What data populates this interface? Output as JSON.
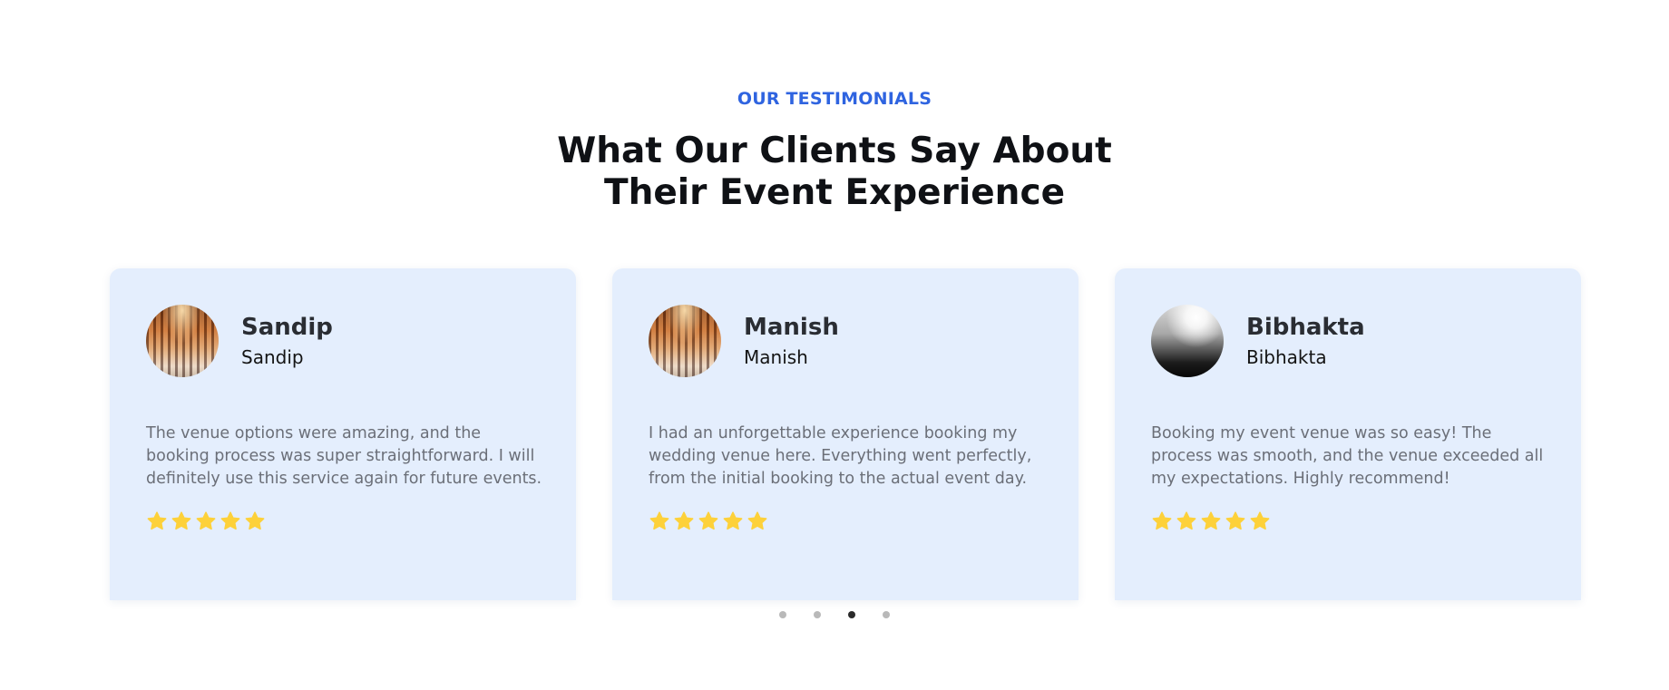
{
  "section": {
    "eyebrow": "OUR TESTIMONIALS",
    "heading": "What Our Clients Say About Their Event Experience"
  },
  "testimonials": [
    {
      "name": "Sandip",
      "role": "Sandip",
      "avatar_icon": "cathedral-arches-photo",
      "quote": "The venue options were amazing, and the booking process was super straightforward. I will definitely use this service again for future events.",
      "rating": 5
    },
    {
      "name": "Manish",
      "role": "Manish",
      "avatar_icon": "cathedral-arches-photo",
      "quote": "I had an unforgettable experience booking my wedding venue here. Everything went perfectly, from the initial booking to the actual event day.",
      "rating": 5
    },
    {
      "name": "Bibhakta",
      "role": "Bibhakta",
      "avatar_icon": "city-skyline-bw-photo",
      "quote": "Booking my event venue was so easy! The process was smooth, and the venue exceeded all my expectations. Highly recommend!",
      "rating": 5
    }
  ],
  "pagination": {
    "count": 4,
    "active_index": 2
  },
  "colors": {
    "accent": "#2f64e0",
    "card_bg": "#e4eefd",
    "star": "#fdd13a",
    "heading": "#0f1115"
  }
}
